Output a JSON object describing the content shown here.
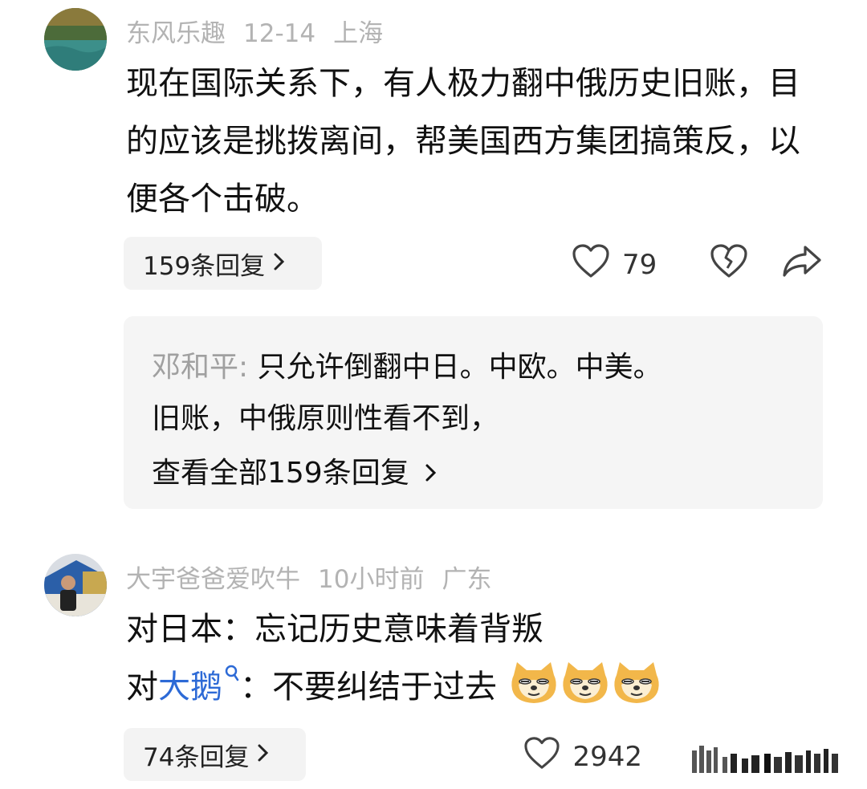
{
  "comments": [
    {
      "author": "东风乐趣",
      "date": "12-14",
      "location": "上海",
      "text": "现在国际关系下，有人极力翻中俄历史旧账，目的应该是挑拨离间，帮美国西方集团搞策反，以便各个击破。",
      "replies_label": "159条回复",
      "likes": "79",
      "icons": [
        "heart-icon",
        "broken-heart-icon",
        "share-icon"
      ],
      "reply_preview": {
        "author": "邓和平:",
        "line1": " 只允许倒翻中日。中欧。中美。",
        "line2": "旧账，中俄原则性看不到，",
        "view_all": "查看全部159条回复"
      }
    },
    {
      "author": "大宇爸爸爱吹牛",
      "date": "10小时前",
      "location": "广东",
      "line1": "对日本：忘记历史意味着背叛",
      "line2_prefix": "对",
      "line2_link": "大鹅",
      "line2_suffix": "：不要纠结于过去",
      "emoji": "doge-emoji",
      "replies_label": "74条回复",
      "likes": "2942",
      "icons": [
        "heart-icon",
        "signal-bars-icon"
      ]
    }
  ],
  "colors": {
    "accent_link": "#2d6ad6",
    "meta_gray": "#b3b3b3",
    "pill_bg": "#f3f3f3"
  }
}
